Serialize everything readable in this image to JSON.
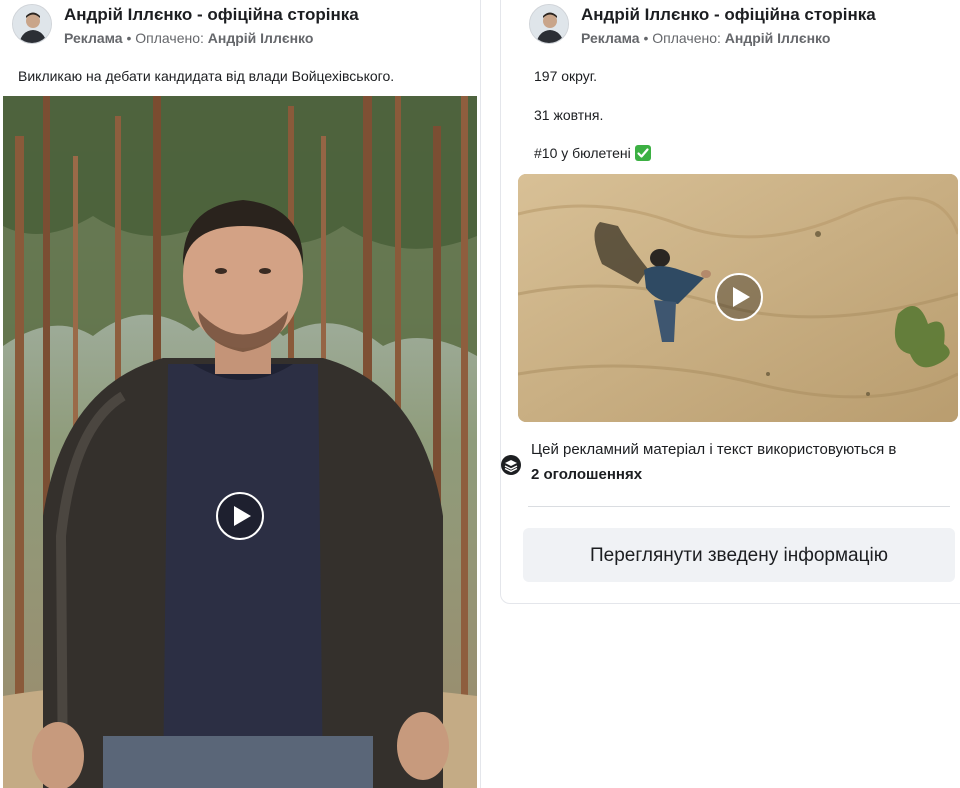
{
  "ads": [
    {
      "page_name": "Андрій Іллєнко - офіційна сторінка",
      "sponsored_label": "Реклама",
      "paid_by_label": "Оплачено:",
      "paid_by_name": "Андрій Іллєнко",
      "text_lines": [
        "Викликаю на дебати кандидата від влади Войцехівського."
      ],
      "media_type": "video"
    },
    {
      "page_name": "Андрій Іллєнко - офіційна сторінка",
      "sponsored_label": "Реклама",
      "paid_by_label": "Оплачено:",
      "paid_by_name": "Андрій Іллєнко",
      "text_lines": [
        "197 округ.",
        "31 жовтня.",
        "#10 у бюлетені"
      ],
      "text_emoji": "✅",
      "media_type": "video",
      "usage_text": "Цей рекламний матеріал і текст використовуються в",
      "usage_count": "2 оголошеннях",
      "summary_button": "Переглянути зведену інформацію"
    }
  ],
  "separator": " • ",
  "icons": {
    "play": "play-icon",
    "usage": "stacked-layers-icon",
    "checkmark": "check-box-emoji"
  },
  "colors": {
    "text_primary": "#1c1e21",
    "text_secondary": "#65676b",
    "button_bg": "#f0f2f5",
    "check_green": "#3cb043"
  }
}
